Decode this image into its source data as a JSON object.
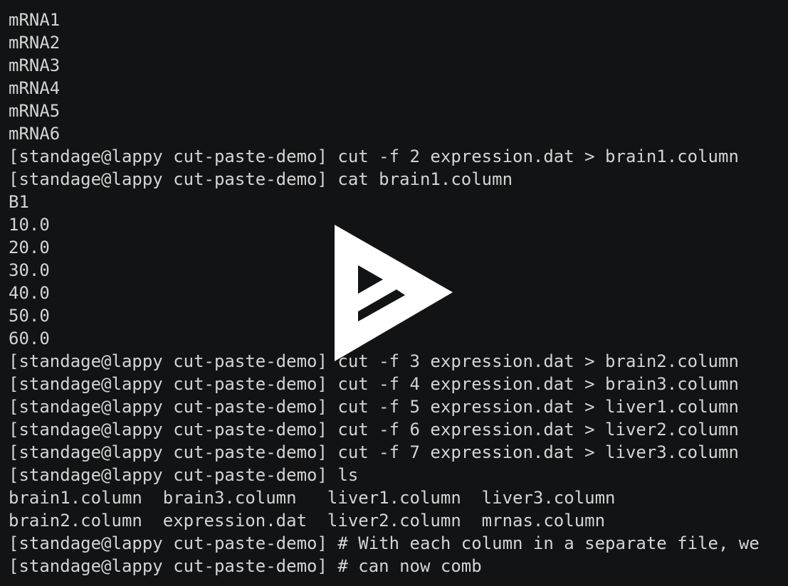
{
  "terminal": {
    "lines": [
      "mRNA1",
      "mRNA2",
      "mRNA3",
      "mRNA4",
      "mRNA5",
      "mRNA6",
      "[standage@lappy cut-paste-demo] cut -f 2 expression.dat > brain1.column",
      "[standage@lappy cut-paste-demo] cat brain1.column",
      "B1",
      "10.0",
      "20.0",
      "30.0",
      "40.0",
      "50.0",
      "60.0",
      "[standage@lappy cut-paste-demo] cut -f 3 expression.dat > brain2.column",
      "[standage@lappy cut-paste-demo] cut -f 4 expression.dat > brain3.column",
      "[standage@lappy cut-paste-demo] cut -f 5 expression.dat > liver1.column",
      "[standage@lappy cut-paste-demo] cut -f 6 expression.dat > liver2.column",
      "[standage@lappy cut-paste-demo] cut -f 7 expression.dat > liver3.column",
      "[standage@lappy cut-paste-demo] ls",
      "brain1.column  brain3.column   liver1.column  liver3.column",
      "brain2.column  expression.dat  liver2.column  mrnas.column",
      "[standage@lappy cut-paste-demo] # With each column in a separate file, we",
      "[standage@lappy cut-paste-demo] # can now comb"
    ]
  },
  "overlay": {
    "icon": "asciinema-play-icon",
    "color": "#ffffff"
  },
  "colors": {
    "background": "#121314",
    "text": "#d4d4d4"
  }
}
